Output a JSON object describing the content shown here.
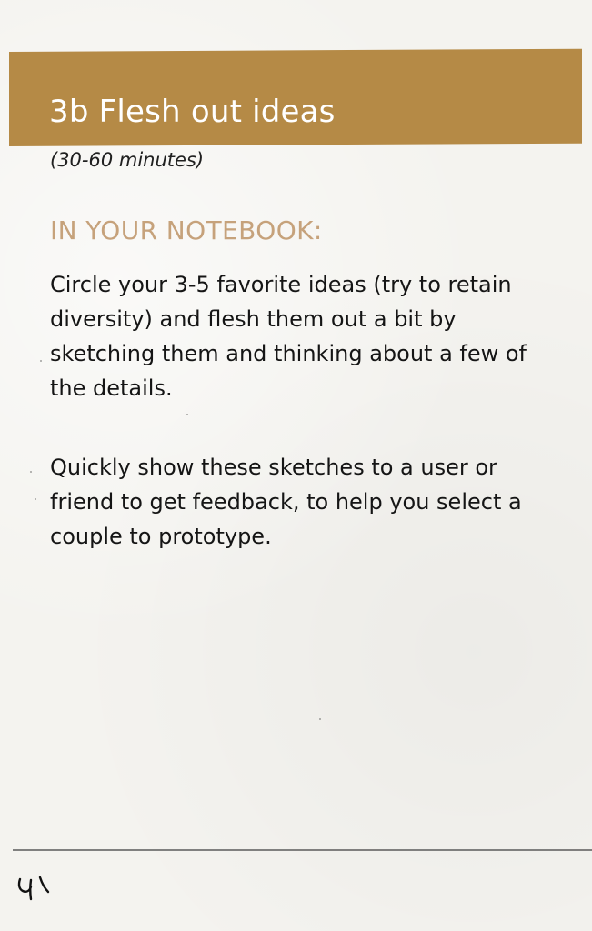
{
  "header": {
    "title": "3b Flesh out ideas",
    "duration": "(30-60 minutes)",
    "band_color": "#b58a46"
  },
  "content": {
    "section_label": "IN YOUR NOTEBOOK:",
    "section_label_color": "#c6a27b",
    "paragraphs": [
      "Circle your 3-5 favorite ideas (try to retain diversity) and flesh them out a bit by sketching them and thinking about a few of the details.",
      "Quickly show these sketches to a user or friend to get feedback, to help you select a couple to prototype."
    ]
  },
  "footer": {
    "handwritten_page_number": "91"
  }
}
